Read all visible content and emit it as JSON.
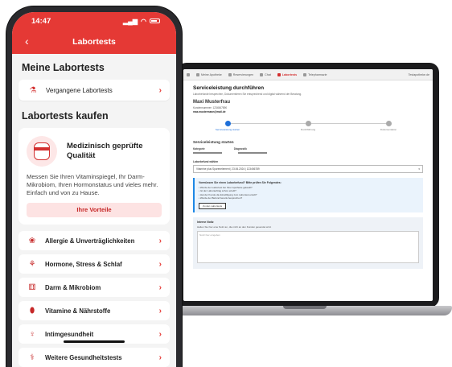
{
  "phone": {
    "status": {
      "time": "14:47",
      "signal": "▂▄▆",
      "wifi": "◠"
    },
    "header": {
      "back_icon": "‹",
      "title": "Labortests"
    },
    "my_tests": {
      "section_title": "Meine Labortests",
      "items": [
        {
          "label": "Vergangene Labortests",
          "icon": "test-tube-icon"
        }
      ]
    },
    "buy": {
      "section_title": "Labortests kaufen",
      "promo": {
        "title": "Medizinisch geprüfte Qualität",
        "text": "Messen Sie Ihren Vitaminspiegel, Ihr Darm-Mikrobiom, Ihren Hormonstatus und vieles mehr. Einfach und von zu Hause.",
        "button": "Ihre Vorteile"
      },
      "categories": [
        {
          "label": "Allergie & Unverträglichkeiten",
          "icon": "allergy-icon",
          "glyph": "❀"
        },
        {
          "label": "Hormone, Stress & Schlaf",
          "icon": "hormone-icon",
          "glyph": "⚘"
        },
        {
          "label": "Darm & Mikrobiom",
          "icon": "gut-icon",
          "glyph": "⚅"
        },
        {
          "label": "Vitamine & Nährstoffe",
          "icon": "vitamin-icon",
          "glyph": "⬮"
        },
        {
          "label": "Intimgesundheit",
          "icon": "intimate-health-icon",
          "glyph": "♀"
        },
        {
          "label": "Weitere Gesundheitstests",
          "icon": "more-tests-icon",
          "glyph": "⚕"
        }
      ]
    }
  },
  "laptop": {
    "nav": [
      {
        "label": "Meine Apotheke",
        "active": false
      },
      {
        "label": "Reservierungen",
        "active": false
      },
      {
        "label": "Chat",
        "active": false
      },
      {
        "label": "Labortests",
        "active": true
      },
      {
        "label": "Telepharmazie",
        "active": false
      }
    ],
    "nav_right": "Testapotheke.de",
    "title": "Serviceleistung durchführen",
    "subtitle": "Laborbefunde besprechen, Dokumentieren Sie entsprechend und digital während der Beratung.",
    "customer": {
      "name": "Maxi Musterfrau",
      "number": "Kundennummer: 1234567890",
      "email": "max.mustermann@mail.de"
    },
    "steps": [
      "Serviceleistung starten",
      "Durchführung",
      "Dokumentation"
    ],
    "section": {
      "title": "Serviceleistung starten",
      "col1": "Kategorie",
      "col2": "Diagnostik"
    },
    "select_label": "Laborbefund wählen",
    "select_value": "Vitamine plus Spurenelement | 23.06.2024 | 123456789",
    "info": {
      "title": "Vormüssen Sie einen Laborbefund? Bitte prüfen Sie Folgendes:",
      "items": [
        "Wurde der Labortest bei Ihrer Apotheke gekauft?",
        "Ist der Laborauftrag schon erteilt?",
        "Hat der Kunde die Einwilligung zum Labortest erteilt?",
        "Wurde der Befund bereits besprochen?"
      ],
      "button": "Zu den Labortests"
    },
    "notes": {
      "title": "Interne Notiz",
      "subtitle": "Halten Sie hier eine Notiz an, die nicht an den Kunden gesendet wird.",
      "placeholder": "Notiz hier eingeben"
    }
  }
}
